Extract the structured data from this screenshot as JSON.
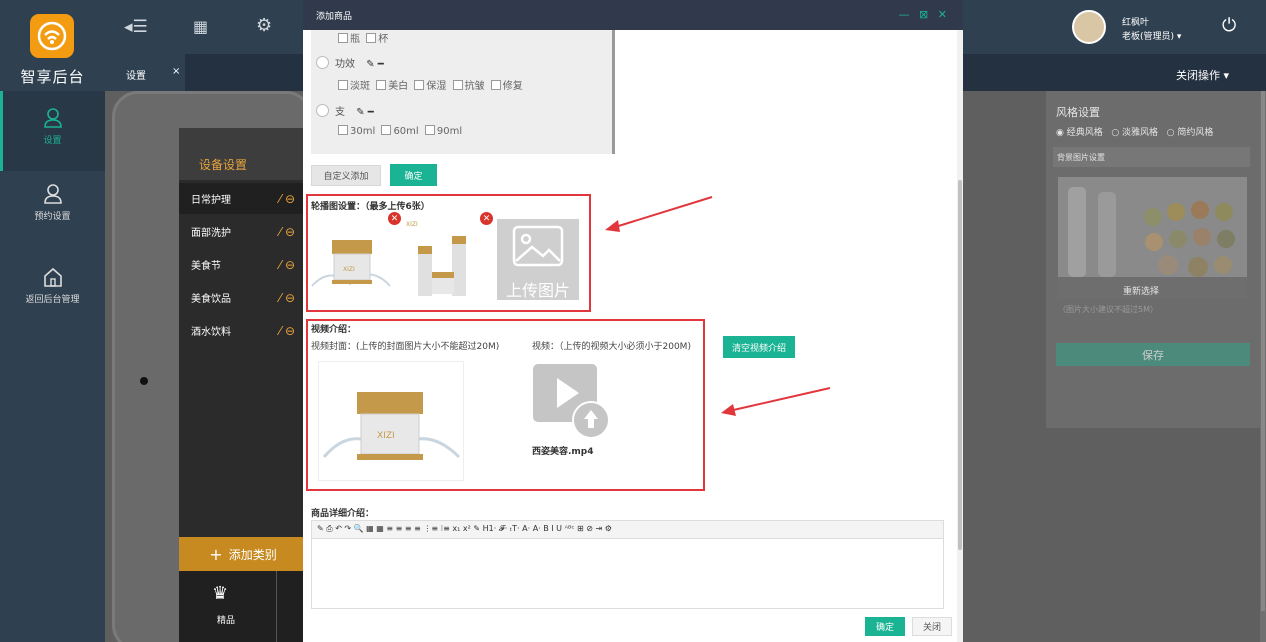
{
  "app": {
    "brand": "智享后台",
    "nav": [
      {
        "label": "设置",
        "icon": "user-icon"
      },
      {
        "label": "预约设置",
        "icon": "user-icon"
      },
      {
        "label": "返回后台管理",
        "icon": "home-icon"
      }
    ],
    "tab": {
      "label": "设置",
      "close": "×"
    },
    "close_ops": "关闭操作",
    "user": {
      "name": "红枫叶",
      "role": "老板(管理员)"
    }
  },
  "device": {
    "title": "设备设置",
    "items": [
      "日常护理",
      "面部洗护",
      "美食节",
      "美食饮品",
      "酒水饮料"
    ],
    "add_label": "添加类别",
    "bottom_label": "精品"
  },
  "style_panel": {
    "title": "风格设置",
    "options": [
      "经典风格",
      "淡雅风格",
      "简约风格"
    ],
    "bg_label": "背景图片设置",
    "reselect": "重新选择",
    "hint": "（图片大小建议不超过5M）",
    "save": "保存"
  },
  "modal": {
    "title": "添加商品",
    "controls": "— ⊠ ✕",
    "attrs": [
      {
        "name": "",
        "options": [
          "瓶",
          "杯"
        ]
      },
      {
        "name": "功效",
        "options": [
          "淡斑",
          "美白",
          "保湿",
          "抗皱",
          "修复"
        ]
      },
      {
        "name": "支",
        "options": [
          "30ml",
          "60ml",
          "90ml"
        ]
      }
    ],
    "custom_add": "自定义添加",
    "confirm_small": "确定",
    "carousel_label": "轮播图设置：（最多上传6张）",
    "upload_text": "上传图片",
    "video_title": "视频介绍：",
    "cover_label": "视频封面：(上传的封面图片大小不能超过20M)",
    "video_label": "视频：（上传的视频大小必须小于200M)",
    "clear_video": "清空视频介绍",
    "video_file": "西姿美容.mp4",
    "detail_label": "商品详细介绍：",
    "toolbar": "✎ ⎙ ↶ ↷ 🔍 ▦ ▦ ≡ ≡ ≡ ≡ ⋮≡ ⁝≡ x₁ x² ✎ H1· 𝓕· ₜT· A· A· B I U ᴬᴮᶜ ⊞ ⊘ ⇥ ⚙",
    "ok": "确定",
    "close": "关闭"
  },
  "colors": {
    "accent": "#1ab394",
    "highlight": "#e2363d",
    "gold": "#e8a33d",
    "navy": "#2f4050"
  }
}
